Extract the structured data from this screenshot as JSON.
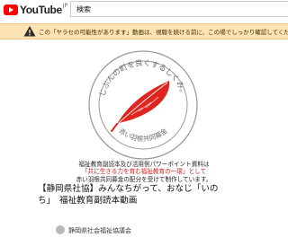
{
  "header": {
    "logo_text": "YouTube",
    "logo_region": "JP",
    "search_value": "検索"
  },
  "banner": {
    "text": "この「ヤラセの可能性があります」動画は、視聴を続ける前に、この場でしっかり確認してください。"
  },
  "thumbnail": {
    "emblem_top_text": "じぶんの町を良くするしくみ。",
    "emblem_bottom_text": "赤い羽根共同募金",
    "desc_line1": "福祉教育副読本及び活用例パワーポイント資料は",
    "desc_line2_red": "「共に生きる力を育む福祉教育の一環」として",
    "desc_line3": "赤い羽根共同募金の配分を受けて制作しています。"
  },
  "video": {
    "title": "【静岡県社協】みんなちがって、おなじ「いの\nち」　福祉教育副読本動画",
    "channel": "静岡県社会福祉協議会"
  },
  "colors": {
    "feather_red": "#e0251f",
    "banner_bg": "#ffe4b3",
    "brand_red": "#ff0000"
  }
}
